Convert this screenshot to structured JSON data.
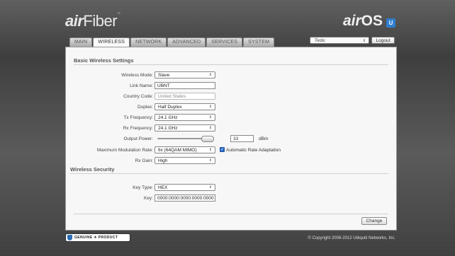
{
  "header": {
    "brand_left_prefix": "air",
    "brand_left_suffix": "Fiber",
    "brand_right_prefix": "air",
    "brand_right_suffix": "OS",
    "logo_letter": "U"
  },
  "tabs": [
    {
      "label": "MAIN"
    },
    {
      "label": "WIRELESS"
    },
    {
      "label": "NETWORK"
    },
    {
      "label": "ADVANCED"
    },
    {
      "label": "SERVICES"
    },
    {
      "label": "SYSTEM"
    }
  ],
  "toolbar": {
    "tools_label": "Tools:",
    "logout_label": "Logout"
  },
  "basic": {
    "title": "Basic Wireless Settings",
    "wireless_mode_label": "Wireless Mode:",
    "wireless_mode_value": "Slave",
    "link_name_label": "Link Name:",
    "link_name_value": "UBNT",
    "country_code_label": "Country Code:",
    "country_code_value": "United States",
    "duplex_label": "Duplex:",
    "duplex_value": "Half Duplex",
    "tx_freq_label": "Tx Frequency:",
    "tx_freq_value": "24.1 GHz",
    "rx_freq_label": "Rx Frequency:",
    "rx_freq_value": "24.1 GHz",
    "output_power_label": "Output Power:",
    "output_power_value": "33",
    "output_power_unit": "dBm",
    "mod_rate_label": "Maximum Modulation Rate:",
    "mod_rate_value": "6x (64QAM MIMO)",
    "auto_rate_label": "Automatic Rate Adaptation",
    "rx_gain_label": "Rx Gain:",
    "rx_gain_value": "High"
  },
  "security": {
    "title": "Wireless Security",
    "key_type_label": "Key Type:",
    "key_type_value": "HEX",
    "key_label": "Key:",
    "key_value": "0000:0000:0000:0000:0000"
  },
  "footer": {
    "change_label": "Change",
    "badge_text": "GENUINE ✈ PRODUCT",
    "copyright": "© Copyright 2006-2012 Ubiquiti Networks, Inc."
  }
}
